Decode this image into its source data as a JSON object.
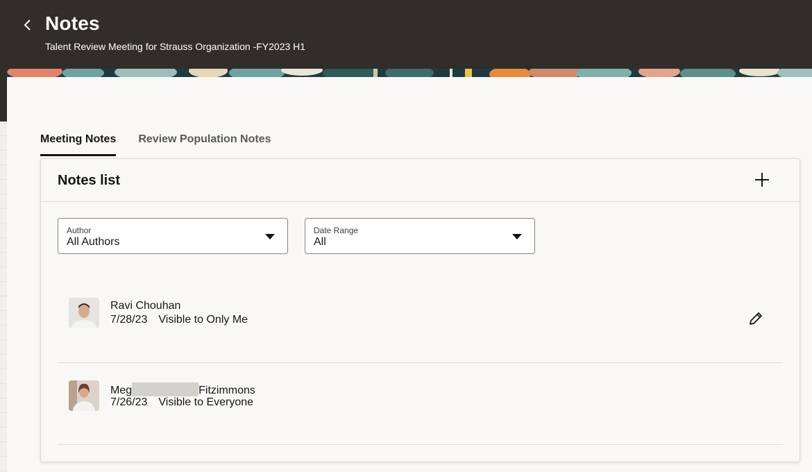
{
  "header": {
    "title": "Notes",
    "subtitle": "Talent Review Meeting for Strauss Organization -FY2023 H1"
  },
  "tabs": [
    {
      "label": "Meeting Notes",
      "active": true
    },
    {
      "label": "Review Population Notes",
      "active": false
    }
  ],
  "notes_card": {
    "title": "Notes list",
    "add_icon": "plus-icon"
  },
  "filters": {
    "author": {
      "label": "Author",
      "value": "All Authors"
    },
    "date_range": {
      "label": "Date Range",
      "value": "All"
    }
  },
  "notes": [
    {
      "author": "Ravi Chouhan",
      "date": "7/28/23",
      "visibility": "Visible to Only Me",
      "editable": true
    },
    {
      "author_first": "Meg",
      "author_last": "Fitzimmons",
      "date": "7/26/23",
      "visibility": "Visible to Everyone",
      "editable": false
    }
  ],
  "colors": {
    "header_bg": "#312d2a",
    "panel_bg": "#f9f8f6",
    "text": "#161513"
  }
}
